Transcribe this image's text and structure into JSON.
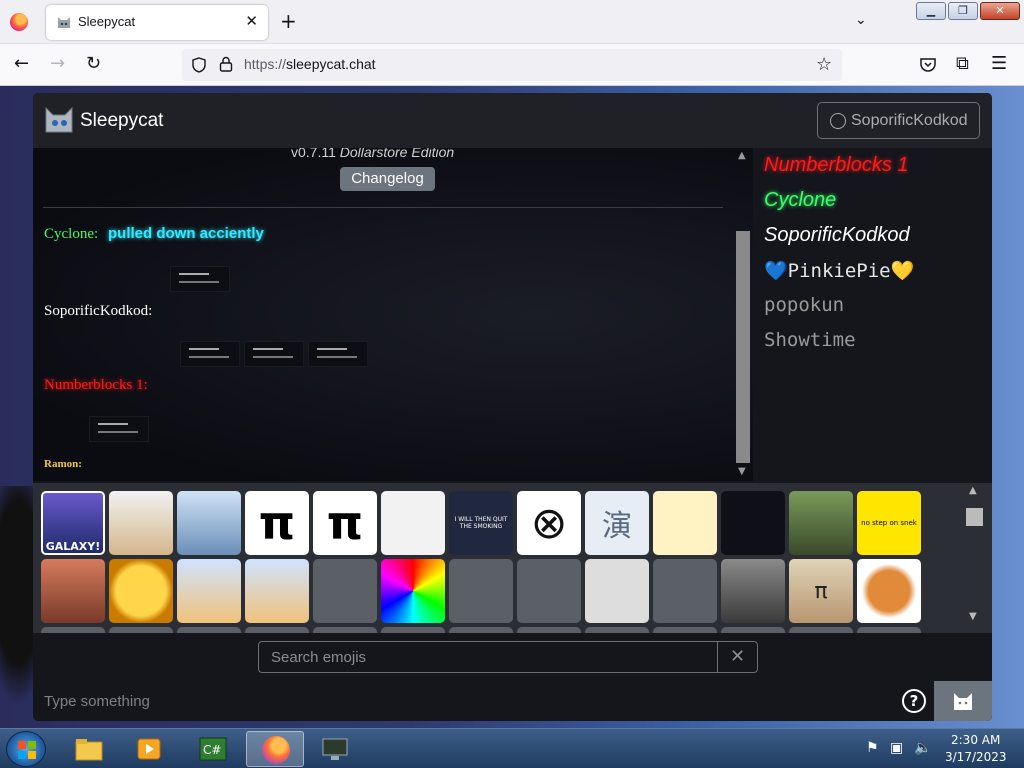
{
  "browser": {
    "tab_title": "Sleepycat",
    "tab_close": "✕",
    "new_tab": "+",
    "url_protocol": "https://",
    "url_host": "sleepycat.chat"
  },
  "app": {
    "title": "Sleepycat",
    "user_button_label": "SoporificKodkod",
    "version_prefix": "v0.7.11 ",
    "version_suffix": "Dollarstore Edition",
    "changelog_label": "Changelog",
    "messages": [
      {
        "name": "Cyclone:",
        "text": "pulled down acciently",
        "name_color": "#39ff6a",
        "text_color": "#34e8ff"
      },
      {
        "name": "SoporificKodkod:",
        "text": "",
        "name_color": "#ffffff",
        "text_color": "#ffffff"
      },
      {
        "name": "Numberblocks 1:",
        "text": "",
        "name_color": "#ff1a1a",
        "text_color": "#ffffff"
      },
      {
        "name": "Ramon:",
        "text": "",
        "name_color": "#f5c542",
        "text_color": "#ffffff"
      }
    ],
    "users": [
      {
        "name": "Numberblocks 1",
        "color": "#ff1a1a",
        "style": "italic"
      },
      {
        "name": "Cyclone",
        "color": "#39ff6a",
        "style": "italic"
      },
      {
        "name": "SoporificKodkod",
        "color": "#ffffff",
        "style": "italic"
      },
      {
        "name": "💙PinkiePie💛",
        "color": "#e6e6e6",
        "style": "normal"
      },
      {
        "name": "popokun",
        "color": "#9a9a9a",
        "style": "normal"
      },
      {
        "name": "Showtime",
        "color": "#9a9a9a",
        "style": "normal"
      }
    ],
    "emoji_search_placeholder": "Search emojis",
    "emoji_search_clear": "✕",
    "compose_placeholder": "Type something",
    "help_label": "?",
    "emoji_tiles": [
      {
        "name": "galaxy-emoji",
        "caption": "GALAXY!"
      },
      {
        "name": "cat-emoji",
        "caption": ""
      },
      {
        "name": "shark-girl-emoji",
        "caption": ""
      },
      {
        "name": "pi-emoji",
        "caption": "π"
      },
      {
        "name": "pi-bold-emoji",
        "caption": "π"
      },
      {
        "name": "screenshot-emoji",
        "caption": ""
      },
      {
        "name": "smoking-emoji",
        "caption": "I WILL THEN QUIT THE SMOKING"
      },
      {
        "name": "x-circle-emoji",
        "caption": ""
      },
      {
        "name": "kanji-emoji",
        "caption": "演"
      },
      {
        "name": "crackers-emoji",
        "caption": ""
      },
      {
        "name": "text-meme-emoji",
        "caption": ""
      },
      {
        "name": "kid-emoji",
        "caption": ""
      },
      {
        "name": "no-step-on-snek-emoji",
        "caption": "no step on snek"
      },
      {
        "name": "face-emoji",
        "caption": ""
      },
      {
        "name": "scream-emoji",
        "caption": ""
      },
      {
        "name": "anime-a-emoji",
        "caption": ""
      },
      {
        "name": "anime-b-emoji",
        "caption": ""
      },
      {
        "name": "salt-emoji",
        "caption": ""
      },
      {
        "name": "spiral-emoji",
        "caption": ""
      },
      {
        "name": "nyan-cat-emoji",
        "caption": ""
      },
      {
        "name": "toast-emoji",
        "caption": ""
      },
      {
        "name": "music-emoji",
        "caption": ""
      },
      {
        "name": "car-emoji",
        "caption": ""
      },
      {
        "name": "rubble-emoji",
        "caption": ""
      },
      {
        "name": "pi-pie-emoji",
        "caption": "π"
      },
      {
        "name": "onion-emoji",
        "caption": ""
      }
    ]
  },
  "taskbar": {
    "time": "2:30 AM",
    "date": "3/17/2023"
  },
  "colors": {
    "app_bg": "#14161c",
    "header_bg": "#1f2126",
    "emoji_panel_bg": "#2b2f35",
    "changelog_bg": "#6c757d"
  }
}
